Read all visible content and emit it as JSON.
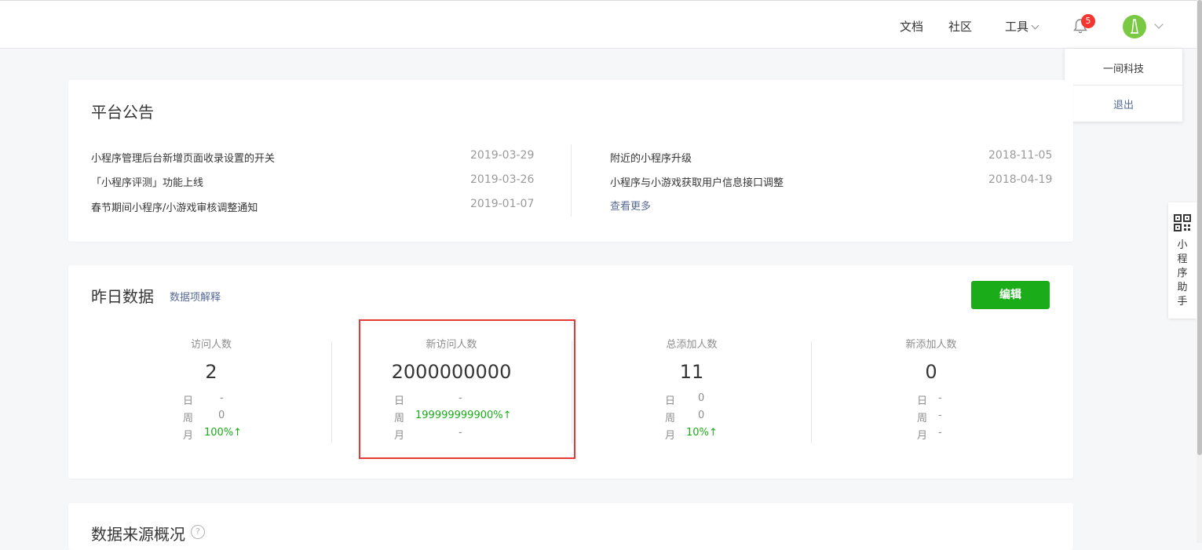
{
  "header": {
    "nav_docs": "文档",
    "nav_community": "社区",
    "nav_tools": "工具",
    "notification_count": "5"
  },
  "account_menu": {
    "company": "一间科技",
    "logout": "退出"
  },
  "announcements": {
    "title": "平台公告",
    "left": [
      {
        "text": "小程序管理后台新增页面收录设置的开关",
        "date": "2019-03-29"
      },
      {
        "text": "「小程序评测」功能上线",
        "date": "2019-03-26"
      },
      {
        "text": "春节期间小程序/小游戏审核调整通知",
        "date": "2019-01-07"
      }
    ],
    "right": [
      {
        "text": "附近的小程序升级",
        "date": "2018-11-05"
      },
      {
        "text": "小程序与小游戏获取用户信息接口调整",
        "date": "2018-04-19"
      }
    ],
    "more_link": "查看更多"
  },
  "yesterday": {
    "title": "昨日数据",
    "explain_link": "数据项解释",
    "edit_button": "编辑",
    "row_labels": {
      "day": "日",
      "week": "周",
      "month": "月"
    },
    "stats": [
      {
        "label": "访问人数",
        "value": "2",
        "day": "-",
        "week": "0",
        "month": "100%↑"
      },
      {
        "label": "新访问人数",
        "value": "2000000000",
        "day": "-",
        "week": "199999999900%↑",
        "month": "-"
      },
      {
        "label": "总添加人数",
        "value": "11",
        "day": "0",
        "week": "0",
        "month": "10%↑"
      },
      {
        "label": "新添加人数",
        "value": "0",
        "day": "-",
        "week": "-",
        "month": "-"
      }
    ]
  },
  "source": {
    "title": "数据来源概况",
    "help": "?"
  },
  "side_widget": {
    "label_chars": [
      "小",
      "程",
      "序",
      "助",
      "手"
    ]
  },
  "colors": {
    "accent_green": "#1aad19",
    "link_blue": "#576b95",
    "badge_red": "#f43530",
    "highlight_red": "#e53935"
  }
}
